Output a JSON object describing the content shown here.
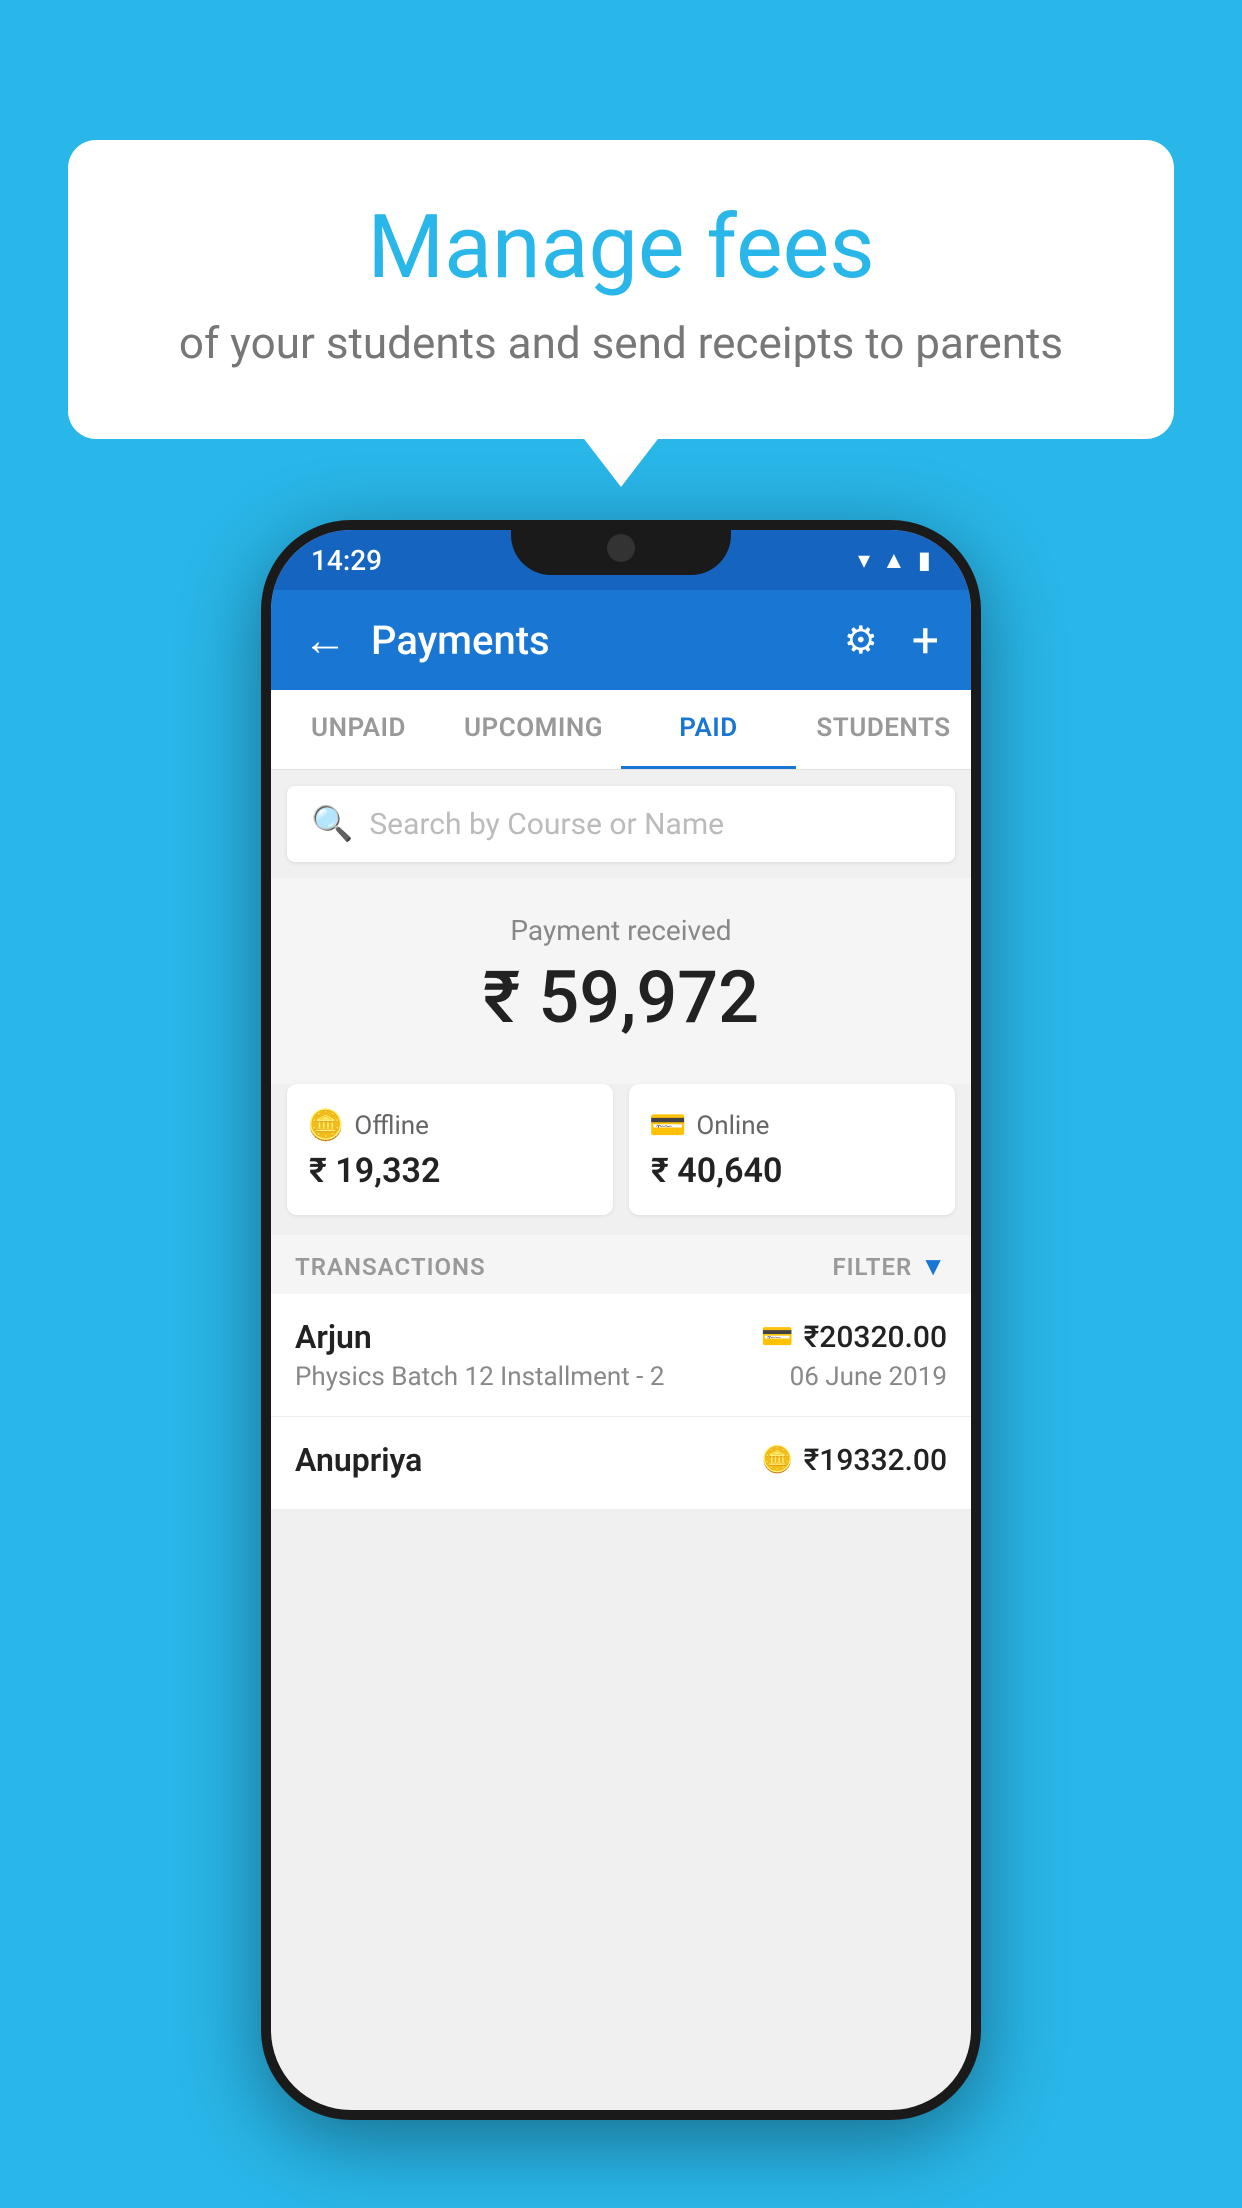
{
  "background_color": "#29b6e8",
  "speech_bubble": {
    "title": "Manage fees",
    "subtitle": "of your students and send receipts to parents"
  },
  "phone": {
    "status_bar": {
      "time": "14:29"
    },
    "header": {
      "title": "Payments",
      "back_label": "←",
      "settings_label": "⚙",
      "add_label": "+"
    },
    "tabs": [
      {
        "label": "UNPAID",
        "active": false
      },
      {
        "label": "UPCOMING",
        "active": false
      },
      {
        "label": "PAID",
        "active": true
      },
      {
        "label": "STUDENTS",
        "active": false
      }
    ],
    "search": {
      "placeholder": "Search by Course or Name"
    },
    "payment_received": {
      "label": "Payment received",
      "amount": "₹ 59,972",
      "offline": {
        "label": "Offline",
        "amount": "₹ 19,332"
      },
      "online": {
        "label": "Online",
        "amount": "₹ 40,640"
      }
    },
    "transactions": {
      "header_label": "TRANSACTIONS",
      "filter_label": "FILTER",
      "items": [
        {
          "name": "Arjun",
          "course": "Physics Batch 12 Installment - 2",
          "amount": "₹20320.00",
          "date": "06 June 2019",
          "type": "online"
        },
        {
          "name": "Anupriya",
          "course": "",
          "amount": "₹19332.00",
          "date": "",
          "type": "offline"
        }
      ]
    }
  }
}
